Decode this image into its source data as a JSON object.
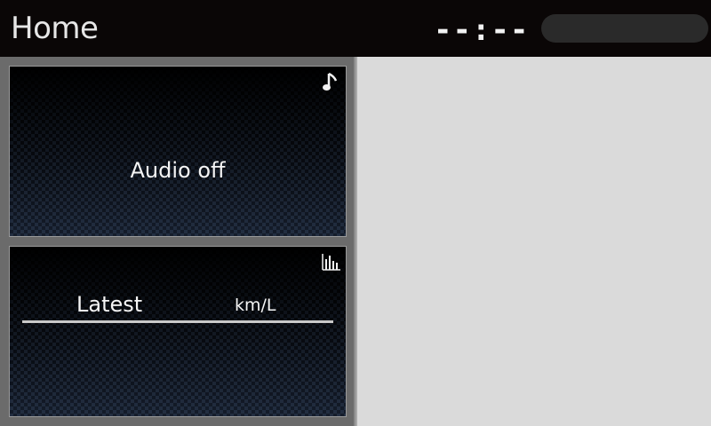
{
  "header": {
    "title": "Home",
    "clock": "--:--"
  },
  "audio_tile": {
    "icon": "music-note-icon",
    "status": "Audio off"
  },
  "fuel_tile": {
    "icon": "bar-chart-icon",
    "label": "Latest",
    "unit": "km/L"
  },
  "colors": {
    "header_bg": "#0a0606",
    "left_panel_bg": "#6b6b6b",
    "right_panel_bg": "#dadada",
    "tile_pattern": "#2b3a52",
    "text": "#f5f5f5"
  }
}
